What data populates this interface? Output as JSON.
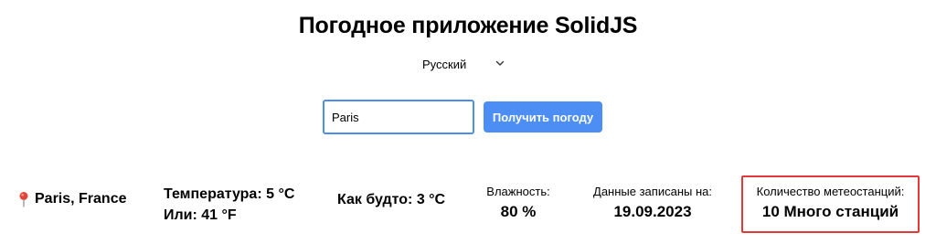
{
  "header": {
    "title": "Погодное приложение SolidJS"
  },
  "language": {
    "selected": "Русский"
  },
  "search": {
    "value": "Paris",
    "button_label": "Получить погоду"
  },
  "weather": {
    "location": "Paris, France",
    "temperature_line": "Температура: 5 °C",
    "fahrenheit_line": "Или: 41 °F",
    "feels_like": "Как будто: 3 °C",
    "humidity_label": "Влажность:",
    "humidity_value": "80 %",
    "recorded_label": "Данные записаны на:",
    "recorded_value": "19.09.2023",
    "stations_label": "Количество метеостанций:",
    "stations_value": "10 Много станций"
  },
  "colors": {
    "accent": "#4c8ef3",
    "input_border": "#4d8fe8",
    "highlight_border": "#e23a3a",
    "pin": "#e0453a"
  }
}
